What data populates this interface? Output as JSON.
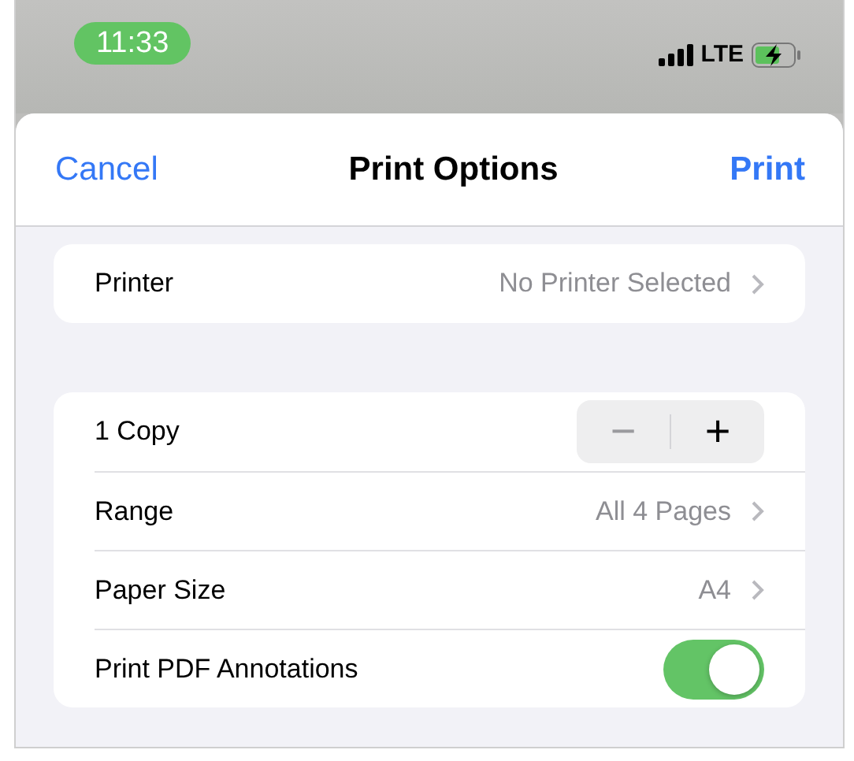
{
  "status_bar": {
    "time": "11:33",
    "network": "LTE"
  },
  "header": {
    "cancel": "Cancel",
    "title": "Print Options",
    "print": "Print"
  },
  "groups": [
    {
      "rows": [
        {
          "kind": "disclosure",
          "label": "Printer",
          "value": "No Printer Selected"
        }
      ]
    },
    {
      "rows": [
        {
          "kind": "stepper",
          "label": "1 Copy",
          "minus_disabled": true,
          "minus": "−",
          "plus": "+"
        },
        {
          "kind": "disclosure",
          "label": "Range",
          "value": "All 4 Pages"
        },
        {
          "kind": "disclosure",
          "label": "Paper Size",
          "value": "A4"
        },
        {
          "kind": "toggle",
          "label": "Print PDF Annotations",
          "on": true
        }
      ]
    }
  ]
}
